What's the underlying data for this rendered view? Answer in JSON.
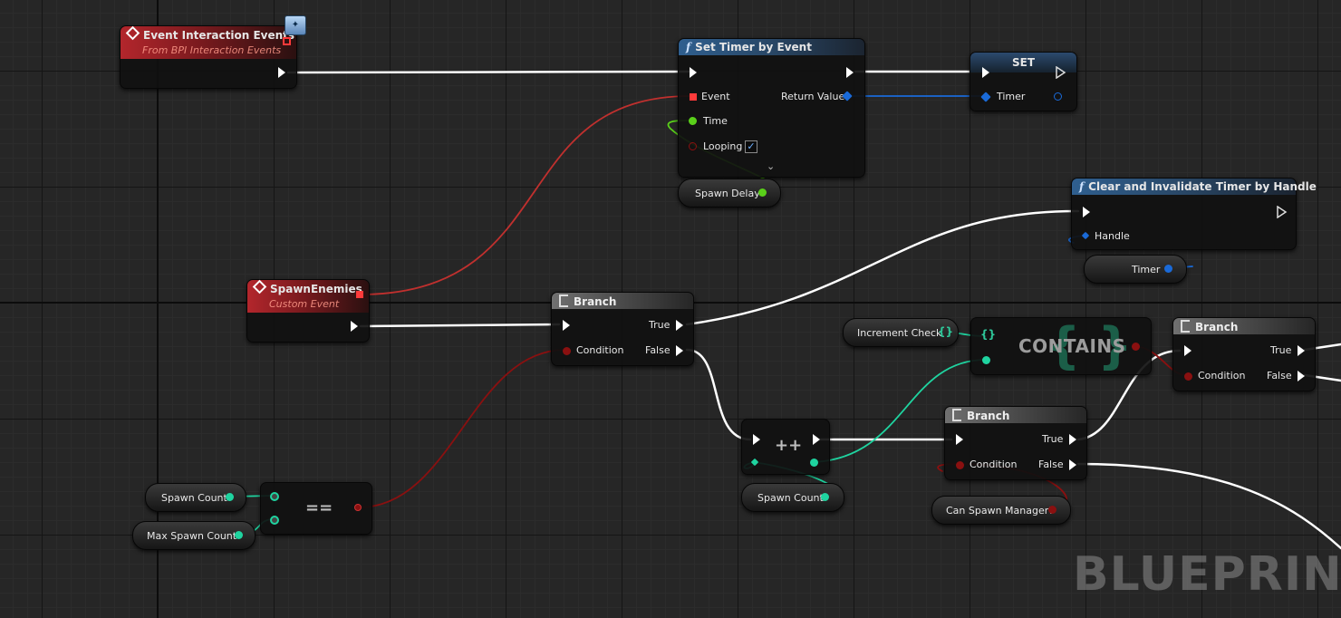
{
  "app": {
    "watermark": "BLUEPRINT"
  },
  "colors": {
    "exec_wire": "#ffffff",
    "event_wire": "#c0302e",
    "bool_wire": "#8a1010",
    "int_wire": "#1fd4a0",
    "float_wire": "#5ad01a",
    "handle_wire": "#1a6ad8",
    "event_header": "#b3262c",
    "function_header": "#2f5f8f"
  },
  "nodes": {
    "event_interaction": {
      "title": "Event Interaction Events",
      "subtitle": "From BPI Interaction Events",
      "icon": "event-diamond-icon",
      "badge_icon": "interface-badge-icon"
    },
    "set_timer": {
      "title": "Set Timer by Event",
      "icon": "function-icon",
      "pins": {
        "event": "Event",
        "time": "Time",
        "looping": "Looping",
        "return_value": "Return Value"
      },
      "looping_checked": true
    },
    "set_var": {
      "title": "SET",
      "pins": {
        "timer": "Timer"
      }
    },
    "clear_timer": {
      "title": "Clear and Invalidate Timer by Handle",
      "icon": "function-icon",
      "pins": {
        "handle": "Handle"
      }
    },
    "spawn_enemies": {
      "title": "SpawnEnemies",
      "subtitle": "Custom Event",
      "icon": "event-diamond-icon"
    },
    "branch_1": {
      "title": "Branch",
      "pins": {
        "condition": "Condition",
        "true": "True",
        "false": "False"
      }
    },
    "branch_2": {
      "title": "Branch",
      "pins": {
        "condition": "Condition",
        "true": "True",
        "false": "False"
      }
    },
    "branch_3": {
      "title": "Branch",
      "pins": {
        "condition": "Condition",
        "true": "True",
        "false": "False"
      }
    },
    "contains": {
      "title": "CONTAINS",
      "icon": "map-icon"
    },
    "equals": {
      "operator": "=="
    },
    "increment": {
      "operator": "++"
    }
  },
  "variables": {
    "spawn_delay": "Spawn Delay",
    "timer": "Timer",
    "spawn_count_1": "Spawn Count",
    "max_spawn_count": "Max Spawn Count",
    "spawn_count_2": "Spawn Count",
    "increment_check": "Increment Check",
    "can_spawn_manager": "Can Spawn Manager?"
  },
  "glyphs": {
    "map": "{}",
    "checkmark": "✓",
    "chevron": "⌄"
  }
}
